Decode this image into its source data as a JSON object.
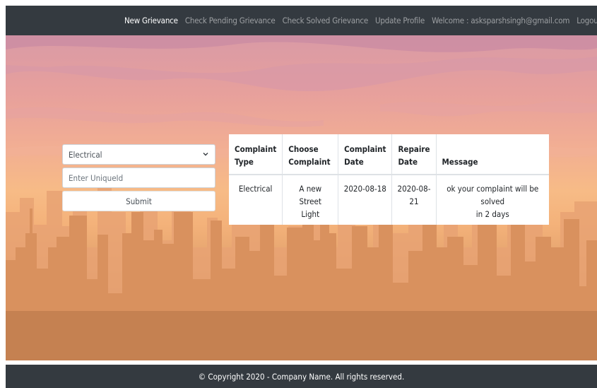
{
  "nav": {
    "items": [
      {
        "label": "New Grievance",
        "active": true
      },
      {
        "label": "Check Pending Grievance",
        "active": false
      },
      {
        "label": "Check Solved Grievance",
        "active": false
      },
      {
        "label": "Update Profile",
        "active": false
      },
      {
        "label": "Welcome : asksparshsingh@gmail.com",
        "active": false
      },
      {
        "label": "Logout",
        "active": false
      }
    ]
  },
  "form": {
    "select_value": "Electrical",
    "uniqueid_placeholder": "Enter UniqueId",
    "submit_label": "Submit"
  },
  "table": {
    "headers": [
      [
        "Complaint",
        "Type"
      ],
      [
        "Choose",
        "Complaint"
      ],
      [
        "Complaint",
        "Date"
      ],
      [
        "Repaire",
        "Date"
      ],
      [
        "",
        "Message"
      ]
    ],
    "row": {
      "type": "Electrical",
      "complaint": [
        "A new Street",
        "Light"
      ],
      "complaint_date": "2020-08-18",
      "repair_date": [
        "2020-08-",
        "21"
      ],
      "message": [
        "ok your complaint will be solved",
        "in 2 days"
      ]
    }
  },
  "footer": {
    "copyright": "© Copyright 2020 - Company Name. All rights reserved."
  },
  "colors": {
    "navbar": "#343a40",
    "nav_inactive": "rgba(255,255,255,0.5)",
    "nav_active": "#ffffff"
  }
}
